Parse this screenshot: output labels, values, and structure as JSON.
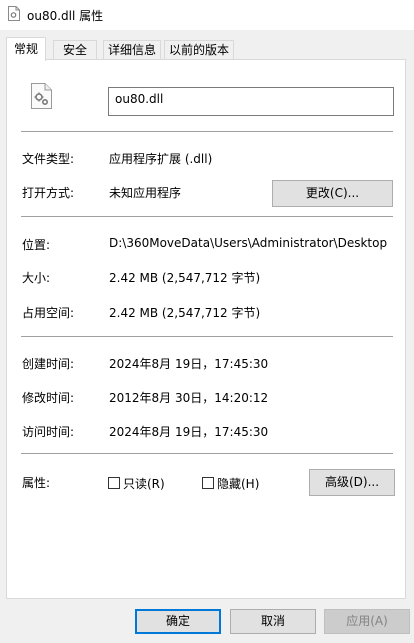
{
  "window": {
    "title": "ou80.dll 属性"
  },
  "tabs": [
    {
      "label": "常规",
      "active": true
    },
    {
      "label": "安全",
      "active": false
    },
    {
      "label": "详细信息",
      "active": false
    },
    {
      "label": "以前的版本",
      "active": false
    }
  ],
  "general": {
    "file_name": "ou80.dll",
    "file_type": {
      "label": "文件类型:",
      "value": "应用程序扩展 (.dll)"
    },
    "open_with": {
      "label": "打开方式:",
      "value": "未知应用程序",
      "change_button": "更改(C)..."
    },
    "location": {
      "label": "位置:",
      "value": "D:\\360MoveData\\Users\\Administrator\\Desktop"
    },
    "size": {
      "label": "大小:",
      "value": "2.42 MB (2,547,712 字节)"
    },
    "size_on_disk": {
      "label": "占用空间:",
      "value": "2.42 MB (2,547,712 字节)"
    },
    "created": {
      "label": "创建时间:",
      "value": "2024年8月 19日，17:45:30"
    },
    "modified": {
      "label": "修改时间:",
      "value": "2012年8月 30日，14:20:12"
    },
    "accessed": {
      "label": "访问时间:",
      "value": "2024年8月 19日，17:45:30"
    },
    "attributes": {
      "label": "属性:",
      "readonly_label": "只读(R)",
      "readonly_checked": false,
      "hidden_label": "隐藏(H)",
      "hidden_checked": false,
      "advanced_button": "高级(D)..."
    }
  },
  "footer": {
    "ok": "确定",
    "cancel": "取消",
    "apply": "应用(A)"
  },
  "icons": {
    "title_icon": "file-gear-icon",
    "file_icon": "dll-file-gear-icon"
  }
}
